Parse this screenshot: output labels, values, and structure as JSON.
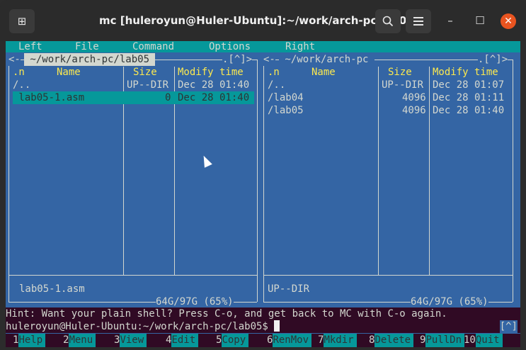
{
  "window": {
    "title": "mc [huleroyun@Huler-Ubuntu]:~/work/arch-pc/lab05",
    "new_tab_icon": "new-tab-icon",
    "search_icon": "search-icon",
    "menu_icon": "hamburger-icon",
    "minimize": "–",
    "maximize": "☐",
    "close": "✕"
  },
  "menubar": [
    "Left",
    "File",
    "Command",
    "Options",
    "Right"
  ],
  "left_panel": {
    "path": " ~/work/arch-pc/lab05 ",
    "left_corner": "<-",
    "right_corner": ".[^]>",
    "headers": {
      "n": ".n",
      "name": "Name",
      "size": "Size",
      "modify": "Modify time"
    },
    "rows": [
      {
        "name": "/..",
        "size": "UP--DIR",
        "modify": "Dec 28 01:40",
        "selected": false
      },
      {
        "name": " lab05-1.asm",
        "size": "0",
        "modify": "Dec 28 01:40",
        "selected": true
      }
    ],
    "status": "lab05-1.asm",
    "disk": "64G/97G (65%)"
  },
  "right_panel": {
    "path": " ~/work/arch-pc ",
    "left_corner": "<-",
    "right_corner": ".[^]>",
    "headers": {
      "n": ".n",
      "name": "Name",
      "size": "Size",
      "modify": "Modify time"
    },
    "rows": [
      {
        "name": "/..",
        "size": "UP--DIR",
        "modify": "Dec 28 01:07"
      },
      {
        "name": "/lab04",
        "size": "4096",
        "modify": "Dec 28 01:11"
      },
      {
        "name": "/lab05",
        "size": "4096",
        "modify": "Dec 28 01:40"
      }
    ],
    "status": "UP--DIR",
    "disk": "64G/97G (65%)"
  },
  "hint": "Hint: Want your plain shell? Press C-o, and get back to MC with C-o again.",
  "prompt": "huleroyun@Huler-Ubuntu:~/work/arch-pc/lab05$ ",
  "prompt_tag": "[^]",
  "fkeys": [
    {
      "num": "1",
      "label": "Help"
    },
    {
      "num": "2",
      "label": "Menu"
    },
    {
      "num": "3",
      "label": "View"
    },
    {
      "num": "4",
      "label": "Edit"
    },
    {
      "num": "5",
      "label": "Copy"
    },
    {
      "num": "6",
      "label": "RenMov"
    },
    {
      "num": "7",
      "label": "Mkdir"
    },
    {
      "num": "8",
      "label": "Delete"
    },
    {
      "num": "9",
      "label": "PullDn"
    },
    {
      "num": "10",
      "label": "Quit"
    }
  ]
}
